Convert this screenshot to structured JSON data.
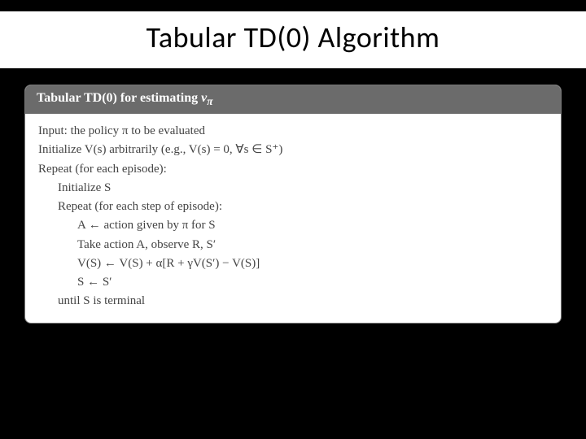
{
  "title": "Tabular TD(0) Algorithm",
  "algo": {
    "header_prefix": "Tabular TD(0) for estimating ",
    "header_symbol": "v",
    "header_sub": "π",
    "lines": {
      "l0": "Input: the policy π to be evaluated",
      "l1": "Initialize V(s) arbitrarily (e.g., V(s) = 0, ∀s ∈ S⁺)",
      "l2": "Repeat (for each episode):",
      "l3": "Initialize S",
      "l4": "Repeat (for each step of episode):",
      "l5": "A ← action given by π for S",
      "l6": "Take action A, observe R, S′",
      "l7": "V(S) ← V(S) + α[R + γV(S′) − V(S)]",
      "l8": "S ← S′",
      "l9": "until S is terminal"
    }
  }
}
